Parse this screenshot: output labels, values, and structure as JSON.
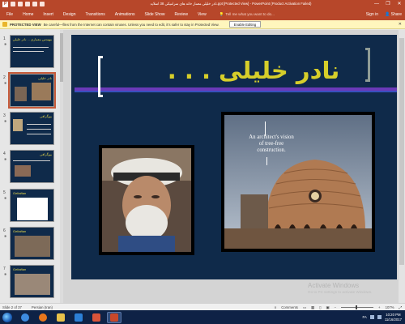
{
  "window": {
    "title": "نادر خلیلی معمار خانه های سرامیکی 38 اسلاید.ppt [Protected View] - PowerPoint (Product Activation Failed)",
    "controls": [
      "—",
      "❐",
      "✕"
    ]
  },
  "ribbon": {
    "tabs": [
      "File",
      "Home",
      "Insert",
      "Design",
      "Transitions",
      "Animations",
      "Slide Show",
      "Review",
      "View"
    ],
    "tell_me": "Tell me what you want to do...",
    "sign_in": "Sign in",
    "share": "Share"
  },
  "protected_view": {
    "label": "PROTECTED VIEW",
    "message": "Be careful—files from the Internet can contain viruses. Unless you need to edit, it's safer to stay in Protected View.",
    "enable_button": "Enable Editing",
    "close": "✕"
  },
  "thumbnails": [
    {
      "number": "1",
      "title": "مهندس معماری ... نادر خلیلی",
      "selected": false
    },
    {
      "number": "2",
      "title": "نادر خلیلی",
      "selected": true
    },
    {
      "number": "3",
      "title": "بیوگرافی",
      "selected": false
    },
    {
      "number": "4",
      "title": "بیوگرافی",
      "selected": false
    },
    {
      "number": "5",
      "title": "Geltaftan",
      "selected": false
    },
    {
      "number": "6",
      "title": "Geltaftan",
      "selected": false
    },
    {
      "number": "7",
      "title": "Geltaftan",
      "selected": false
    }
  ],
  "slide": {
    "title": "نادر خلیلی . . .",
    "caption": "An architect's vision of tree-free construction."
  },
  "watermark": {
    "line1": "Activate Windows",
    "line2": "Go to PC settings to activate Windows."
  },
  "status": {
    "slide_info": "Slide 2 of 37",
    "language": "Persian (Iran)",
    "comments": "Comments",
    "zoom": "107%"
  },
  "taskbar": {
    "apps": [
      "internet-explorer",
      "firefox",
      "file-explorer",
      "media-player",
      "paint",
      "powerpoint"
    ],
    "language": "FA",
    "time": "10:20 PM",
    "date": "11/16/2017"
  }
}
